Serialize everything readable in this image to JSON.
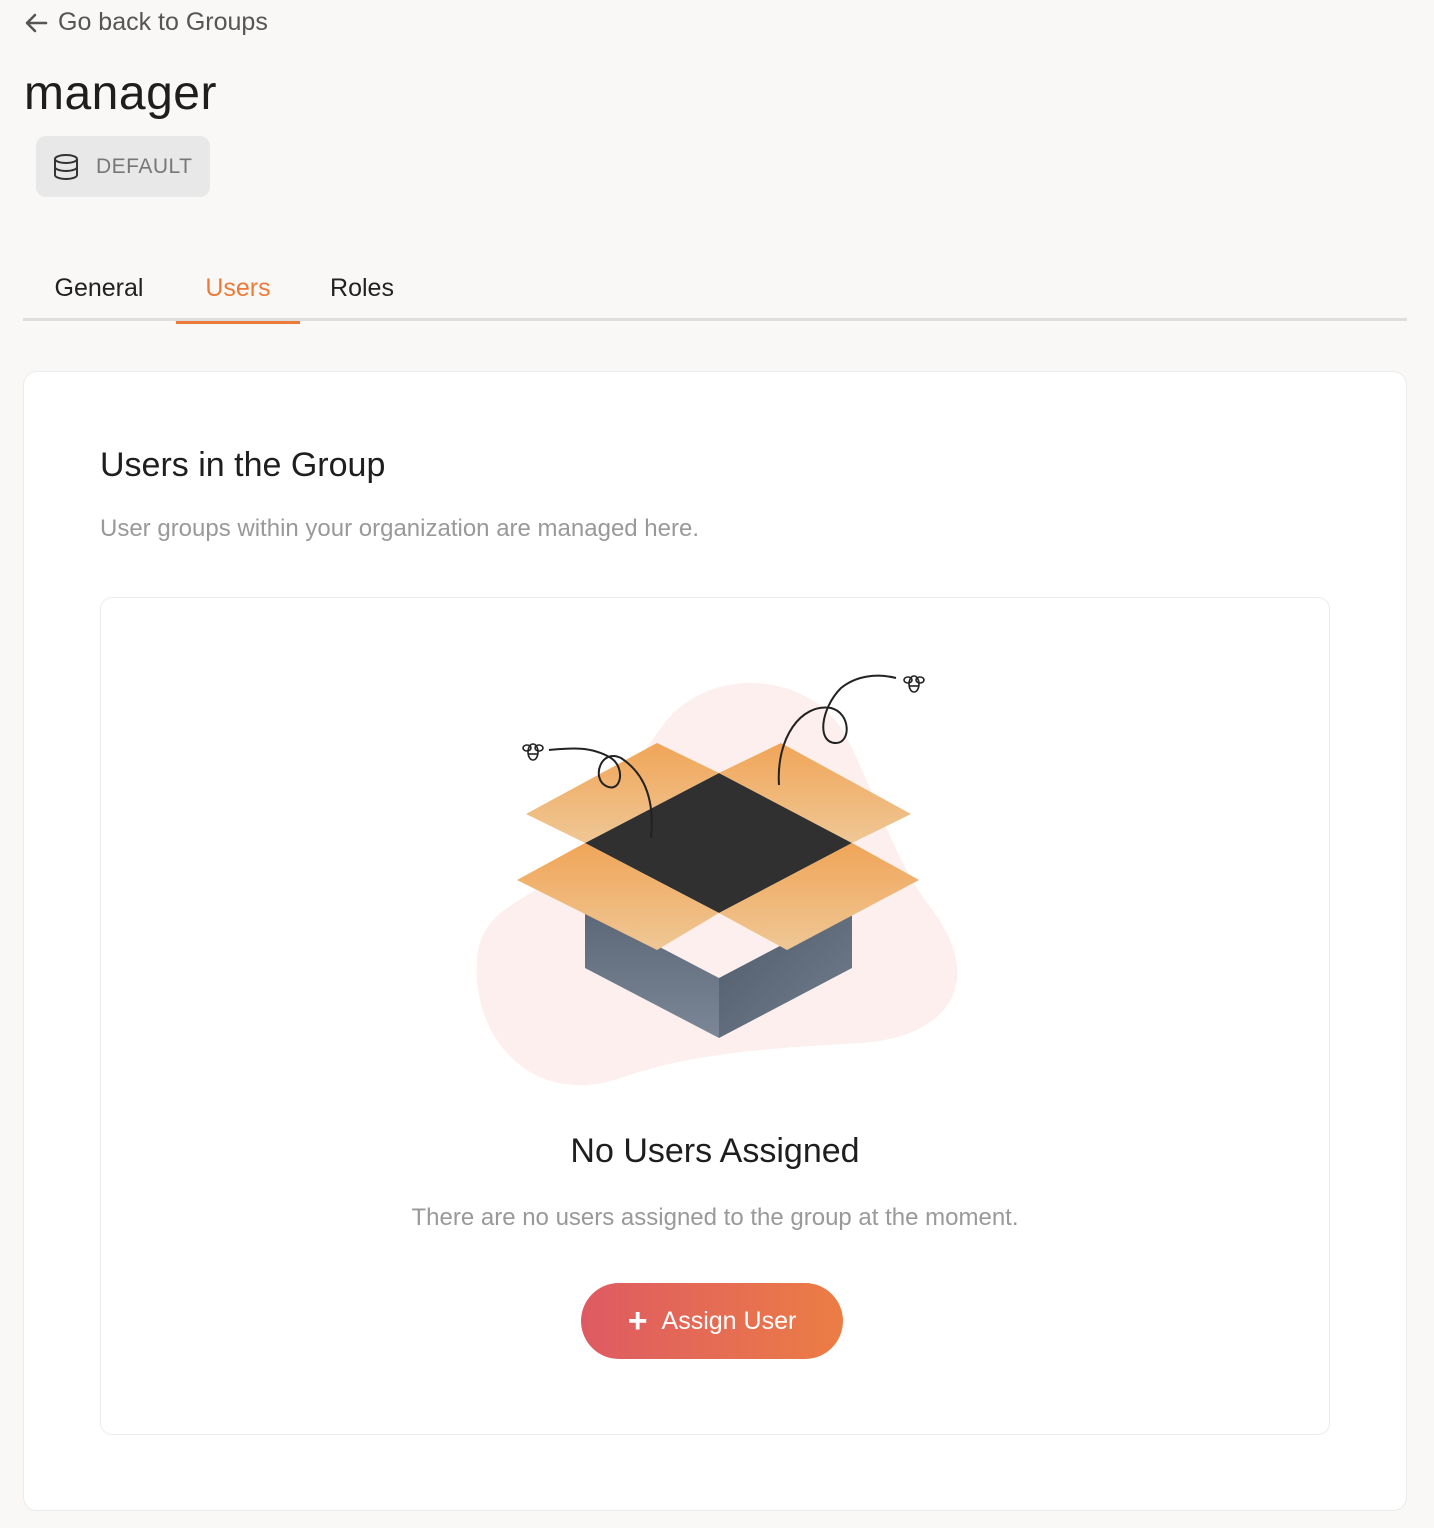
{
  "back_link": {
    "icon": "arrow-left-icon",
    "label": "Go back to Groups"
  },
  "group": {
    "name": "manager",
    "realm_icon": "database-icon",
    "realm_label": "DEFAULT"
  },
  "tabs": [
    {
      "label": "General",
      "active": false
    },
    {
      "label": "Users",
      "active": true
    },
    {
      "label": "Roles",
      "active": false
    }
  ],
  "card": {
    "title": "Users in the Group",
    "description": "User groups within your organization are managed here."
  },
  "empty_state": {
    "illustration": "open-box-illustration",
    "title": "No Users Assigned",
    "description": "There are no users assigned to the group at the moment.",
    "button_icon": "plus-icon",
    "button_label": "Assign User"
  },
  "colors": {
    "accent": "#ec7b3a",
    "button_gradient_start": "#de5a63",
    "button_gradient_end": "#ec7d45"
  }
}
